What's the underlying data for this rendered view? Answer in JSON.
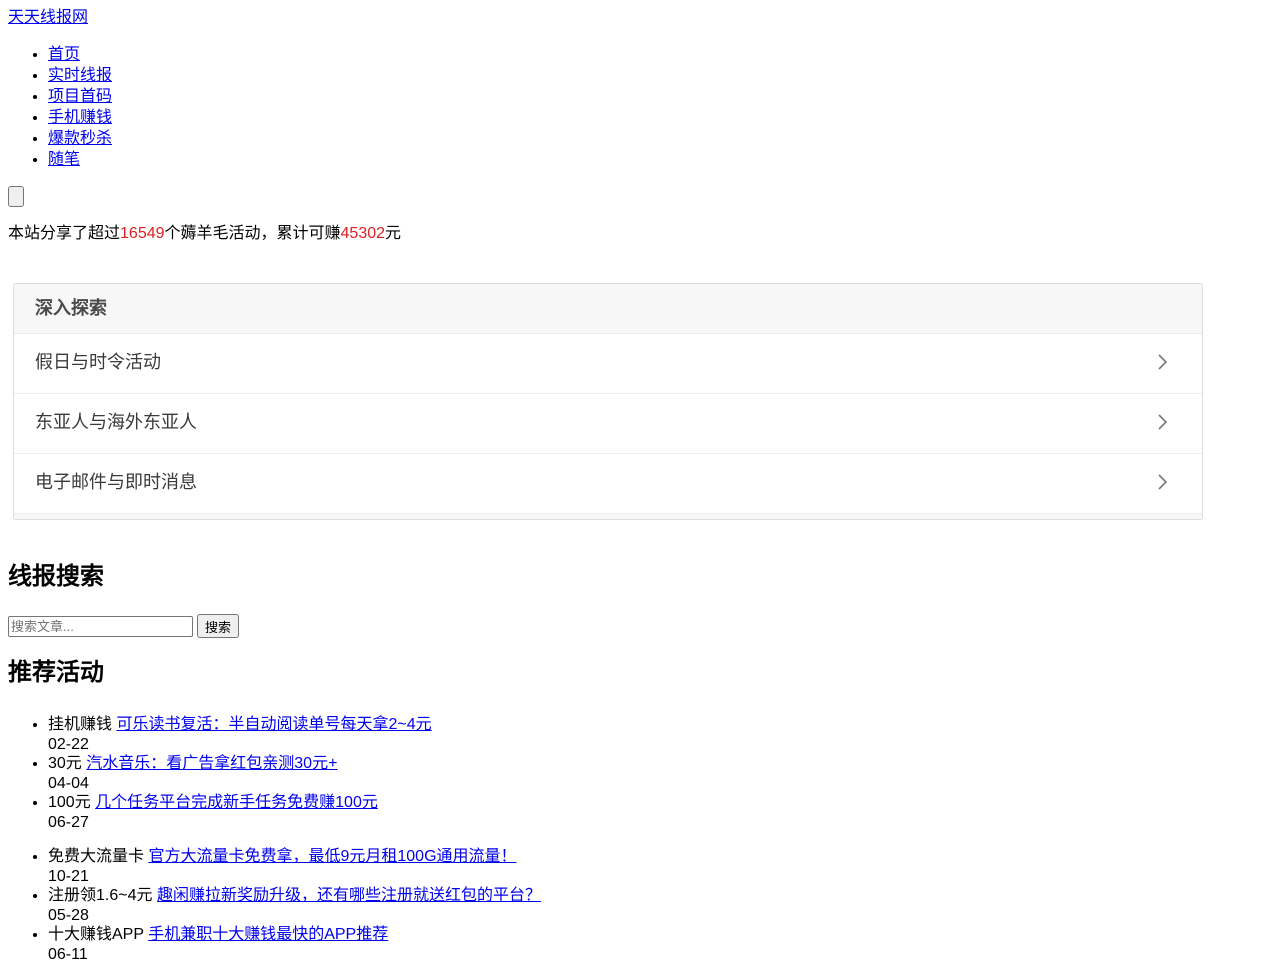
{
  "site": {
    "title": "天天线报网"
  },
  "nav": {
    "items": [
      "首页",
      "实时线报",
      "项目首码",
      "手机赚钱",
      "爆款秒杀",
      "随笔"
    ]
  },
  "stats": {
    "prefix": "本站分享了超过",
    "activities": "16549",
    "middle": "个薅羊毛活动，累计可赚",
    "total": "45302",
    "suffix": "元",
    "highlight_color": "#e02020"
  },
  "explore": {
    "heading": "深入探索",
    "items": [
      {
        "label": "假日与时令活动",
        "icon": "chevron-right-icon"
      },
      {
        "label": "东亚人与海外东亚人",
        "icon": "chevron-right-icon"
      },
      {
        "label": "电子邮件与即时消息",
        "icon": "chevron-right-icon"
      }
    ]
  },
  "search": {
    "heading": "线报搜索",
    "placeholder": "搜索文章...",
    "button_label": "搜索"
  },
  "recommended": {
    "heading": "推荐活动",
    "groups": [
      [
        {
          "tag": "挂机赚钱",
          "title": "可乐读书复活：半自动阅读单号每天拿2~4元",
          "date": "02-22"
        },
        {
          "tag": "30元",
          "title": "汽水音乐：看广告拿红包亲测30元+",
          "date": "04-04"
        },
        {
          "tag": "100元",
          "title": "几个任务平台完成新手任务免费赚100元",
          "date": "06-27"
        }
      ],
      [
        {
          "tag": "免费大流量卡",
          "title": "官方大流量卡免费拿，最低9元月租100G通用流量！",
          "date": "10-21"
        },
        {
          "tag": "注册领1.6~4元",
          "title": "趣闲赚拉新奖励升级，还有哪些注册就送红包的平台？",
          "date": "05-28"
        },
        {
          "tag": "十大赚钱APP",
          "title": "手机兼职十大赚钱最快的APP推荐",
          "date": "06-11"
        }
      ]
    ]
  }
}
